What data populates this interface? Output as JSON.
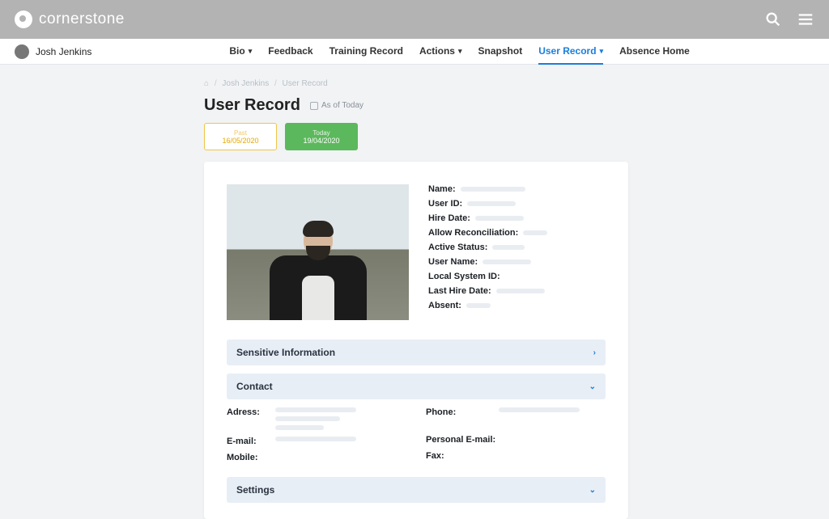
{
  "brand": "cornerstone",
  "user": {
    "name": "Josh Jenkins"
  },
  "nav": [
    {
      "label": "Bio",
      "dropdown": true
    },
    {
      "label": "Feedback",
      "dropdown": false
    },
    {
      "label": "Training Record",
      "dropdown": false
    },
    {
      "label": "Actions",
      "dropdown": true
    },
    {
      "label": "Snapshot",
      "dropdown": false
    },
    {
      "label": "User Record",
      "dropdown": true,
      "active": true
    },
    {
      "label": "Absence Home",
      "dropdown": false
    }
  ],
  "breadcrumb": {
    "home_icon": "home-icon",
    "items": [
      "Josh Jenkins",
      "User Record"
    ]
  },
  "page": {
    "title": "User Record",
    "as_of_label": "As of Today"
  },
  "pills": {
    "past": {
      "label": "Past",
      "date": "16/05/2020"
    },
    "today": {
      "label": "Today",
      "date": "19/04/2020"
    }
  },
  "profile_fields": [
    "Name:",
    "User ID:",
    "Hire Date:",
    "Allow Reconciliation:",
    "Active Status:",
    "User Name:",
    "Local System ID:",
    "Last Hire Date:",
    "Absent:"
  ],
  "accordions": {
    "sensitive": "Sensitive Information",
    "contact": "Contact",
    "settings": "Settings"
  },
  "contact_fields": {
    "left": [
      "Adress:",
      "E-mail:",
      "Mobile:"
    ],
    "right": [
      "Phone:",
      "Personal E-mail:",
      "Fax:"
    ]
  }
}
